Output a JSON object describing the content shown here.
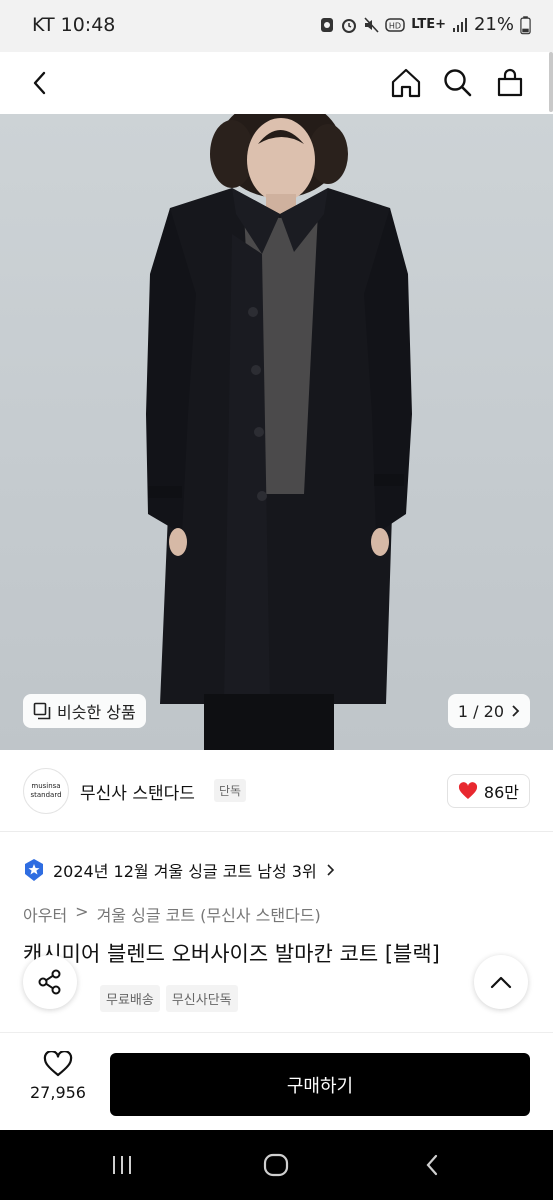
{
  "status": {
    "carrier_time": "KT 10:48",
    "network": "LTE+",
    "battery": "21%",
    "icons": [
      "notification-icon",
      "alarm-icon",
      "mute-icon",
      "hd-icon",
      "lte-icon",
      "signal-icon",
      "battery-icon"
    ]
  },
  "nav": {
    "icons": [
      "back-icon",
      "home-icon",
      "search-icon",
      "cart-icon"
    ]
  },
  "hero": {
    "similar_label": "비슷한 상품",
    "page_indicator": "1 / 20",
    "current_image": 1,
    "total_images": 20
  },
  "brand": {
    "logo_line1": "musinsa",
    "logo_line2": "standard",
    "name": "무신사 스탠다드",
    "tag": "단독",
    "likes": "86만"
  },
  "product": {
    "rank": "2024년 12월 겨울 싱글 코트 남성 3위",
    "breadcrumbs": [
      "아우터",
      "겨울 싱글 코트 (무신사 스탠다드)"
    ],
    "title": "캐시미어 블렌드 오버사이즈 발마칸 코트 [블랙]",
    "tags": [
      "무료배송",
      "무신사단독"
    ]
  },
  "bottom": {
    "wish_count": "27,956",
    "buy_label": "구매하기"
  },
  "colors": {
    "accent_blue": "#2f6de1",
    "heart_red": "#e8282f",
    "buy_bg": "#000000"
  }
}
